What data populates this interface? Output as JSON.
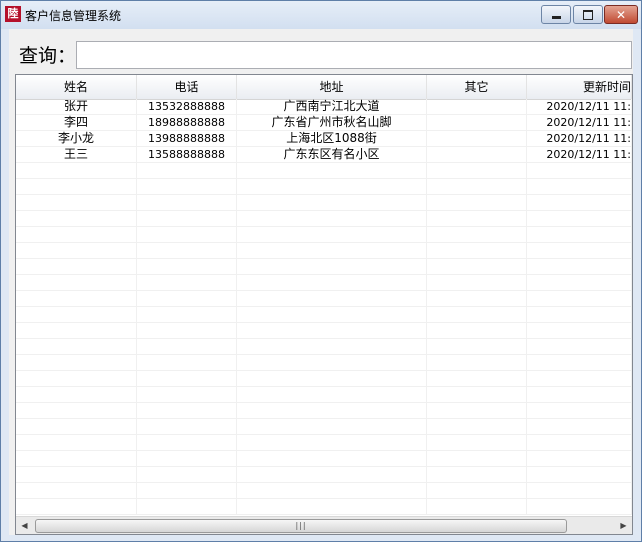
{
  "window": {
    "title": "客户信息管理系统",
    "icon": "app-logo-icon",
    "icon_glyph": "陸",
    "close_glyph": "✕"
  },
  "search": {
    "label": "查询：",
    "value": "",
    "placeholder": ""
  },
  "table": {
    "columns": [
      "姓名",
      "电话",
      "地址",
      "其它",
      "更新时间"
    ],
    "rows": [
      [
        "张开",
        "13532888888",
        "广西南宁江北大道",
        "",
        "2020/12/11 11:"
      ],
      [
        "李四",
        "18988888888",
        "广东省广州市秋名山脚",
        "",
        "2020/12/11 11:"
      ],
      [
        "李小龙",
        "13988888888",
        "上海北区1088街",
        "",
        "2020/12/11 11:"
      ],
      [
        "王三",
        "13588888888",
        "广东东区有名小区",
        "",
        "2020/12/11 11:"
      ]
    ],
    "empty_rows": 22
  },
  "scrollbar": {
    "left_arrow": "◀",
    "right_arrow": "▶",
    "grip": "|||"
  },
  "colors": {
    "title_bar": "#dae5f3",
    "close_button": "#c94a33",
    "grid_line": "#f0f0f0"
  }
}
